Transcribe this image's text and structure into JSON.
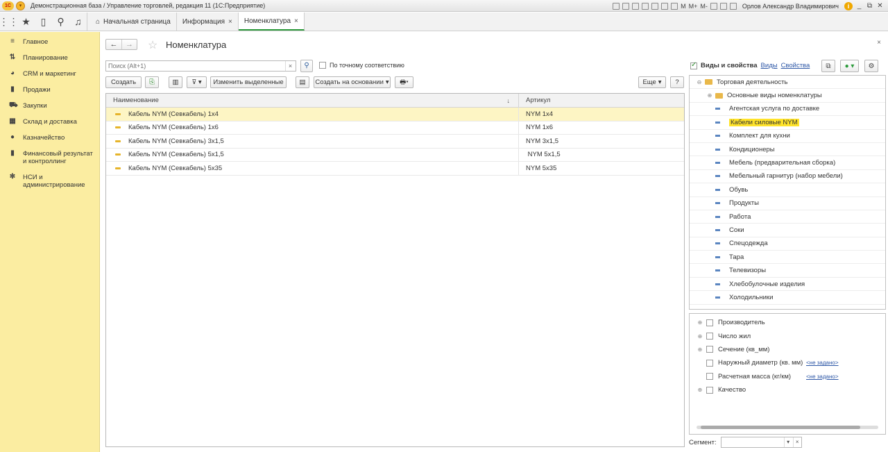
{
  "window": {
    "title": "Демонстрационная база / Управление торговлей, редакция 11  (1С:Предприятие)",
    "logo_text": "1С",
    "mem_buttons": [
      "M",
      "M+",
      "M-"
    ],
    "user": "Орлов Александр Владимирович"
  },
  "tabs": [
    {
      "label": "Начальная страница",
      "closable": false
    },
    {
      "label": "Информация",
      "closable": true
    },
    {
      "label": "Номенклатура",
      "closable": true,
      "active": true
    }
  ],
  "tab_close": "×",
  "sidebar": {
    "items": [
      {
        "label": "Главное",
        "icon": "menu-icon",
        "glyph": "≡"
      },
      {
        "label": "Планирование",
        "icon": "planning-icon",
        "glyph": "⇅"
      },
      {
        "label": "CRM и маркетинг",
        "icon": "pie-icon",
        "glyph": "◕"
      },
      {
        "label": "Продажи",
        "icon": "bag-icon",
        "glyph": "▮"
      },
      {
        "label": "Закупки",
        "icon": "cart-icon",
        "glyph": "⛟"
      },
      {
        "label": "Склад и доставка",
        "icon": "warehouse-icon",
        "glyph": "▦"
      },
      {
        "label": "Казначейство",
        "icon": "coin-icon",
        "glyph": "●"
      },
      {
        "label": "Финансовый результат и контроллинг",
        "icon": "chart-icon",
        "glyph": "▮"
      },
      {
        "label": "НСИ и администрирование",
        "icon": "gear-icon",
        "glyph": "✻"
      }
    ]
  },
  "page": {
    "title": "Номенклатура",
    "close": "×"
  },
  "search": {
    "placeholder": "Поиск (Alt+1)",
    "clear": "×",
    "exact_label": "По точному соответствию"
  },
  "toolbar": {
    "create": "Создать",
    "edit_selected": "Изменить выделенные",
    "create_based": "Создать на основании",
    "more": "Еще",
    "help": "?"
  },
  "grid": {
    "columns": [
      "Наименование",
      "Артикул"
    ],
    "sort_indicator": "↓",
    "rows": [
      {
        "name": "Кабель NYM (Севкабель) 1x4",
        "sku": "NYM 1x4",
        "selected": true
      },
      {
        "name": "Кабель NYM (Севкабель) 1x6",
        "sku": "NYM 1x6"
      },
      {
        "name": "Кабель NYM (Севкабель) 3x1,5",
        "sku": "NYM 3x1,5"
      },
      {
        "name": "Кабель NYM (Севкабель) 5x1,5",
        "sku": " NYM 5x1,5"
      },
      {
        "name": "Кабель NYM (Севкабель) 5x35",
        "sku": "NYM 5x35"
      }
    ]
  },
  "right_panel": {
    "check_label": "Виды и свойства",
    "link_kinds": "Виды",
    "link_props": "Свойства",
    "tree": {
      "root": "Торговая деятельность",
      "group": "Основные виды номенклатуры",
      "items": [
        "Агентская услуга по доставке",
        "Кабели силовые NYM",
        "Комплект для кухни",
        "Кондиционеры",
        "Мебель (предварительная сборка)",
        "Мебельный гарнитур (набор мебели)",
        "Обувь",
        "Продукты",
        "Работа",
        "Соки",
        "Спецодежда",
        "Тара",
        "Телевизоры",
        "Хлебобулочные изделия",
        "Холодильники"
      ],
      "highlighted": "Кабели силовые NYM"
    },
    "properties": [
      {
        "label": "Производитель",
        "expandable": true,
        "value": ""
      },
      {
        "label": "Число жил",
        "expandable": true,
        "value": ""
      },
      {
        "label": "Сечение (кв_мм)",
        "expandable": true,
        "value": ""
      },
      {
        "label": "Наружный диаметр (кв. мм)",
        "expandable": false,
        "value": "<не задано>"
      },
      {
        "label": "Расчетная масса (кг/км)",
        "expandable": false,
        "value": "<не задано>"
      },
      {
        "label": "Качество",
        "expandable": true,
        "value": ""
      }
    ],
    "segment_label": "Сегмент:"
  },
  "colors": {
    "sidebar_bg": "#fbeda1",
    "selected_row": "#fdf5c4",
    "highlight": "#ffe32a",
    "active_tab_accent": "#2d9a3c",
    "link": "#2c56a6"
  }
}
